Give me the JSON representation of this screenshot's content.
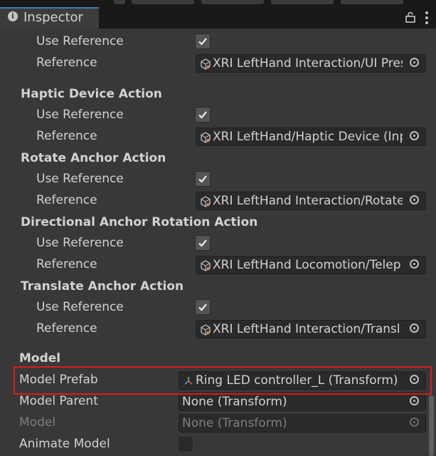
{
  "tab": {
    "title": "Inspector",
    "icon": "info-icon"
  },
  "sections": [
    {
      "rows": [
        {
          "label": "Use Reference",
          "checked": true
        },
        {
          "label": "Reference",
          "value": "XRI LeftHand Interaction/UI Press"
        }
      ]
    },
    {
      "title": "Haptic Device Action",
      "rows": [
        {
          "label": "Use Reference",
          "checked": true
        },
        {
          "label": "Reference",
          "value": "XRI LeftHand/Haptic Device (Input"
        }
      ]
    },
    {
      "title": "Rotate Anchor Action",
      "rows": [
        {
          "label": "Use Reference",
          "checked": true
        },
        {
          "label": "Reference",
          "value": "XRI LeftHand Interaction/Rotate"
        }
      ]
    },
    {
      "title": "Directional Anchor Rotation Action",
      "rows": [
        {
          "label": "Use Reference",
          "checked": true
        },
        {
          "label": "Reference",
          "value": "XRI LeftHand Locomotion/Telep"
        }
      ]
    },
    {
      "title": "Translate Anchor Action",
      "rows": [
        {
          "label": "Use Reference",
          "checked": true
        },
        {
          "label": "Reference",
          "value": "XRI LeftHand Interaction/Transl"
        }
      ]
    }
  ],
  "model": {
    "title": "Model",
    "model_prefab": {
      "label": "Model Prefab",
      "value": "Ring LED controller_L (Transform)"
    },
    "model_parent": {
      "label": "Model Parent",
      "value": "None (Transform)"
    },
    "model": {
      "label": "Model",
      "value": "None (Transform)"
    },
    "animate_model": {
      "label": "Animate Model",
      "checked": false
    }
  },
  "colors": {
    "highlight": "#d61e1e",
    "tab_accent": "#3a79bb"
  }
}
